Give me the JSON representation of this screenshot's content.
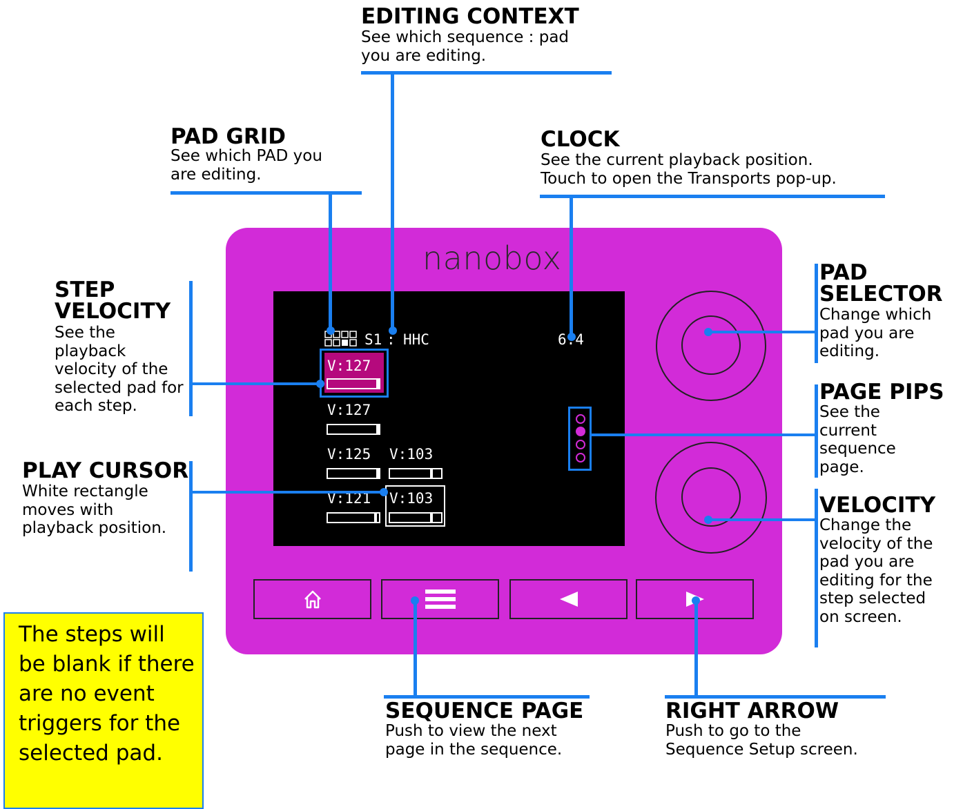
{
  "device": {
    "brand": "nanobox",
    "screen": {
      "seq_label": "S1",
      "sep": ":",
      "pad_name": "HHC",
      "clock": "6:4",
      "steps": [
        {
          "label": "V:127",
          "level": 1.0,
          "selected": true
        },
        {
          "label": "V:127",
          "level": 1.0
        },
        {
          "label": "V:125",
          "level": 0.98
        },
        {
          "label": "V:103",
          "level": 0.81
        },
        {
          "label": "V:121",
          "level": 0.95
        },
        {
          "label": "V:103",
          "level": 0.81,
          "cursor": true
        }
      ],
      "page_pips": {
        "count": 4,
        "active": 2
      }
    },
    "buttons": {
      "home_icon": "home-icon",
      "menu_icon": "hamburger-icon",
      "left_icon": "left-triangle-icon",
      "right_icon": "right-triangle-icon"
    }
  },
  "annotations": {
    "editing_context": {
      "title": "EDITING CONTEXT",
      "desc1": "See which sequence : pad",
      "desc2": "you are editing."
    },
    "pad_grid": {
      "title": "PAD GRID",
      "desc1": "See which PAD you",
      "desc2": "are editing."
    },
    "clock": {
      "title": "CLOCK",
      "desc1": "See the current playback position.",
      "desc2": "Touch to open the Transports pop-up."
    },
    "step_velocity": {
      "title1": "STEP",
      "title2": "VELOCITY",
      "desc": "See the playback velocity of the selected pad for each step."
    },
    "play_cursor": {
      "title": "PLAY CURSOR",
      "desc": "White rectangle moves with playback position."
    },
    "pad_selector": {
      "title1": "PAD",
      "title2": "SELECTOR",
      "desc": "Change which pad you are editing."
    },
    "page_pips": {
      "title": "PAGE PIPS",
      "desc": "See the current sequence page."
    },
    "velocity": {
      "title": "VELOCITY",
      "desc": "Change the velocity of the pad you are editing for the step selected on screen."
    },
    "sequence_page": {
      "title": "SEQUENCE PAGE",
      "desc1": "Push to view the next",
      "desc2": "page in the sequence."
    },
    "right_arrow": {
      "title": "RIGHT ARROW",
      "desc1": "Push to go to the",
      "desc2": "Sequence Setup screen."
    }
  },
  "note": {
    "text": "The steps will be blank if there are no event triggers for the selected pad."
  },
  "colors": {
    "callout": "#1a7ff0",
    "device": "#d22bd8",
    "screen": "#000000",
    "highlight": "#b5097d",
    "note_bg": "#ffff00"
  }
}
